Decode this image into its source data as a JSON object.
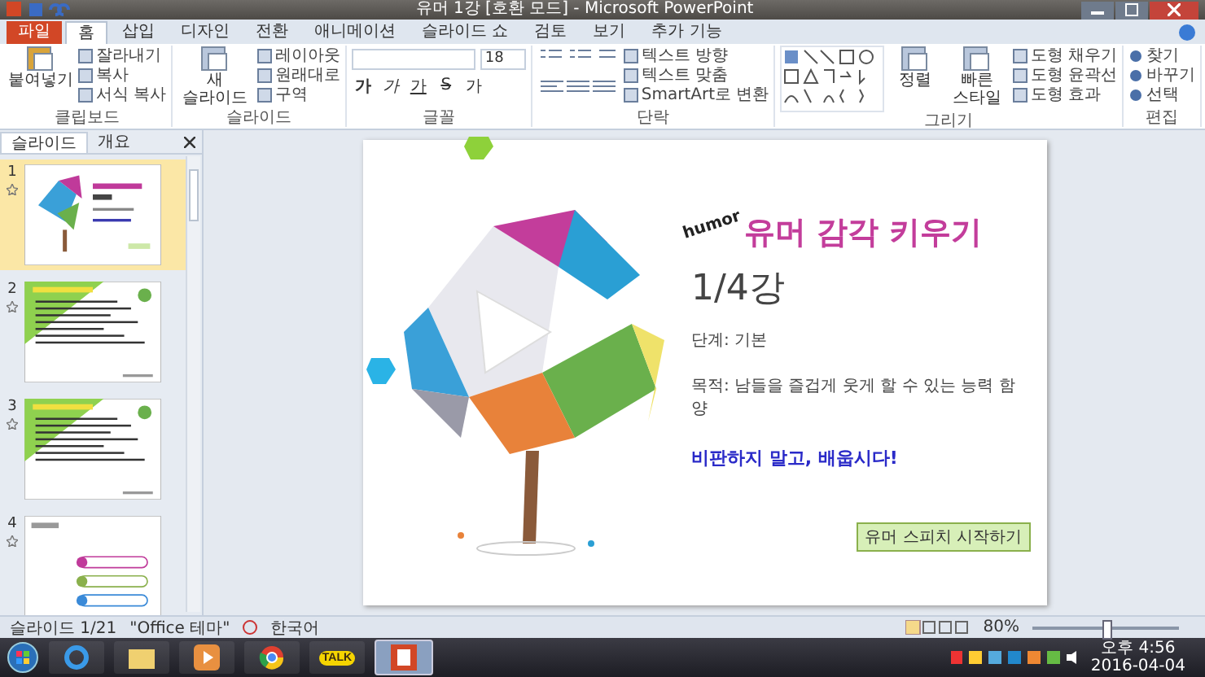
{
  "window": {
    "title": "유머 1강 [호환 모드] - Microsoft PowerPoint"
  },
  "ribbon_tabs": [
    {
      "label": "파일",
      "kind": "file",
      "selected": false
    },
    {
      "label": "홈",
      "kind": "tab",
      "selected": true
    },
    {
      "label": "삽입",
      "kind": "tab",
      "selected": false
    },
    {
      "label": "디자인",
      "kind": "tab",
      "selected": false
    },
    {
      "label": "전환",
      "kind": "tab",
      "selected": false
    },
    {
      "label": "애니메이션",
      "kind": "tab",
      "selected": false
    },
    {
      "label": "슬라이드 쇼",
      "kind": "tab",
      "selected": false
    },
    {
      "label": "검토",
      "kind": "tab",
      "selected": false
    },
    {
      "label": "보기",
      "kind": "tab",
      "selected": false
    },
    {
      "label": "추가 기능",
      "kind": "tab",
      "selected": false
    }
  ],
  "ribbon_groups": [
    {
      "kind": "buttons",
      "label": "클립보드",
      "big": [
        "붙여넣기"
      ],
      "small": [
        "잘라내기",
        "복사",
        "서식 복사"
      ]
    },
    {
      "kind": "buttons",
      "label": "슬라이드",
      "big": [
        "새 슬라이드"
      ],
      "small": [
        "레이아웃",
        "원래대로",
        "구역"
      ]
    },
    {
      "kind": "font",
      "label": "글꼴",
      "size": "18",
      "format": [
        "가",
        "가",
        "가",
        "S",
        "가"
      ]
    },
    {
      "kind": "paragraph",
      "label": "단락",
      "small": [
        "텍스트 방향",
        "텍스트 맞춤",
        "SmartArt로 변환"
      ]
    },
    {
      "kind": "drawing",
      "label": "그리기",
      "big": [
        "정렬",
        "빠른 스타일"
      ],
      "small": [
        "도형 채우기",
        "도형 윤곽선",
        "도형 효과"
      ]
    },
    {
      "kind": "edit",
      "label": "편집",
      "small": [
        "찾기",
        "바꾸기",
        "선택"
      ]
    }
  ],
  "slide_panel": {
    "tabs": [
      {
        "label": "슬라이드",
        "selected": true
      },
      {
        "label": "개요",
        "selected": false
      }
    ],
    "thumbnails": [
      {
        "number": "1",
        "kind": "title",
        "selected": true
      },
      {
        "number": "2",
        "kind": "content",
        "selected": false
      },
      {
        "number": "3",
        "kind": "content",
        "selected": false
      },
      {
        "number": "4",
        "kind": "menu",
        "selected": false
      }
    ]
  },
  "slide": {
    "tag": "humor",
    "title": "유머 감각 키우기",
    "subtitle": "1/4강",
    "lines": [
      "단계: 기본",
      "목적: 남들을 즐겁게 웃게 할 수 있는 능력 함양"
    ],
    "slogan": "비판하지 말고, 배웁시다!",
    "button": "유머 스피치 시작하기"
  },
  "status_bar": {
    "slide": "슬라이드 1/21",
    "theme": "\"Office 테마\"",
    "language": "한국어",
    "zoom": "80%",
    "zoom_slider": {
      "level": 0.5
    }
  },
  "taskbar": {
    "apps": [
      {
        "kind": "ie",
        "selected": false
      },
      {
        "kind": "folder",
        "selected": false
      },
      {
        "kind": "media",
        "selected": false
      },
      {
        "kind": "chrome",
        "selected": false
      },
      {
        "kind": "talk",
        "label": "TALK",
        "selected": false
      },
      {
        "kind": "powerpoint",
        "selected": true
      }
    ],
    "time": "오후 4:56",
    "date": "2016-04-04"
  }
}
